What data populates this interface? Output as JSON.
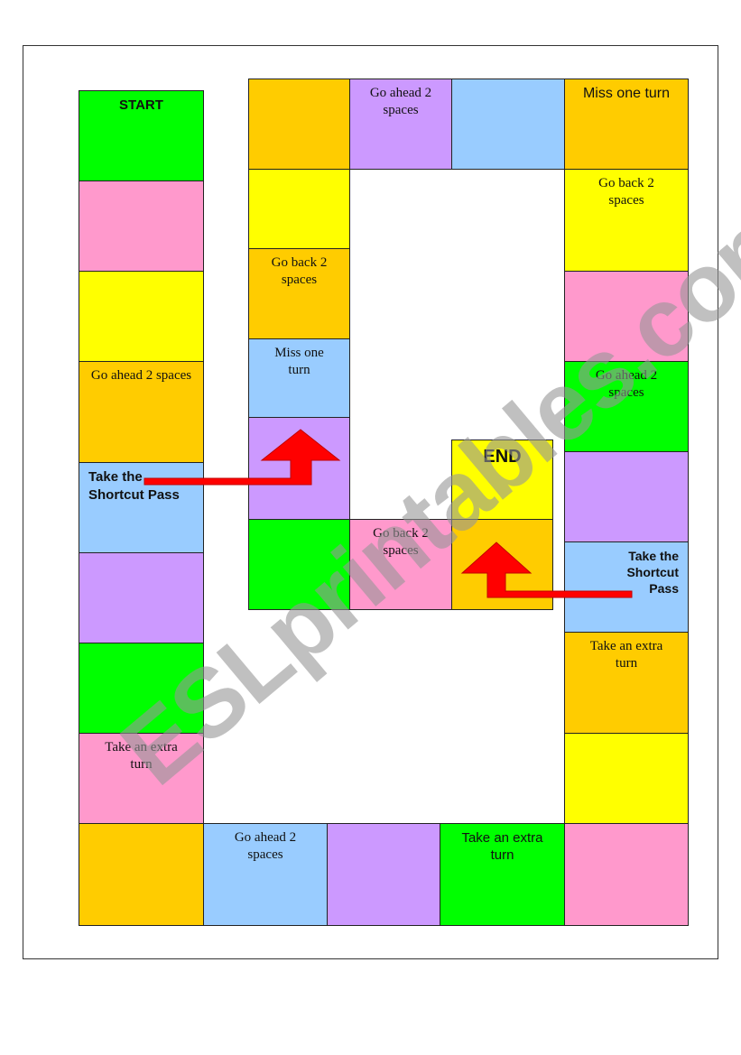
{
  "board": {
    "start": "START",
    "end": "END",
    "left_column": [
      "Go ahead 2 spaces",
      "Take the Shortcut Pass",
      "Take an extra turn"
    ],
    "bottom_row": [
      "Go ahead 2 spaces",
      "Take an extra turn"
    ],
    "right_column": [
      "Miss one turn",
      "Go back 2 spaces",
      "Go ahead 2 spaces",
      "Take the Shortcut Pass",
      "Take an extra turn"
    ],
    "top_row": [
      "Go ahead 2 spaces"
    ],
    "inner": [
      "Go back 2 spaces",
      "Miss one turn",
      "Go back 2 spaces"
    ]
  },
  "colors": {
    "green": "#00ff00",
    "pink": "#ff99cc",
    "yellow": "#ffff00",
    "orange": "#ffcc00",
    "purple": "#cc99ff",
    "blue": "#99ccff",
    "arrow": "#ff0000"
  },
  "watermark": "ESLprintables.com"
}
